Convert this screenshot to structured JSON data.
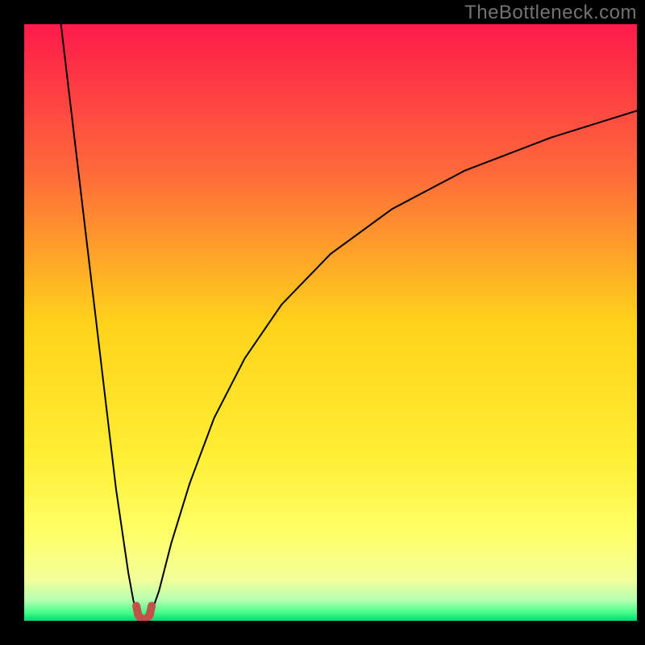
{
  "watermark": "TheBottleneck.com",
  "chart_data": {
    "type": "line",
    "title": "",
    "xlabel": "",
    "ylabel": "",
    "xlim": [
      0,
      100
    ],
    "ylim": [
      0,
      100
    ],
    "grid": false,
    "legend": false,
    "background_gradient": {
      "stops": [
        {
          "pct": 0,
          "color": "#ff1a4b"
        },
        {
          "pct": 25,
          "color": "#ff6a3a"
        },
        {
          "pct": 50,
          "color": "#ffd21a"
        },
        {
          "pct": 72,
          "color": "#ffee33"
        },
        {
          "pct": 85,
          "color": "#ffff66"
        },
        {
          "pct": 93,
          "color": "#f3ff99"
        },
        {
          "pct": 96.5,
          "color": "#b7ffb0"
        },
        {
          "pct": 98.5,
          "color": "#4dff8a"
        },
        {
          "pct": 100,
          "color": "#00d973"
        }
      ]
    },
    "series": [
      {
        "name": "left-branch",
        "color": "#000000",
        "width": 2,
        "x": [
          6.0,
          7.5,
          9.0,
          10.5,
          12.0,
          13.5,
          15.0,
          16.0,
          17.0,
          17.8,
          18.4,
          18.8
        ],
        "y": [
          100,
          87,
          74,
          61,
          48,
          35,
          22,
          15,
          8,
          3.5,
          1.0,
          0.2
        ]
      },
      {
        "name": "right-branch",
        "color": "#000000",
        "width": 2,
        "x": [
          20.2,
          20.8,
          22.0,
          24.0,
          27.0,
          31.0,
          36.0,
          42.0,
          50.0,
          60.0,
          72.0,
          86.0,
          100.0
        ],
        "y": [
          0.2,
          1.5,
          5.0,
          13.0,
          23.0,
          34.0,
          44.0,
          53.0,
          61.5,
          69.0,
          75.5,
          81.0,
          85.5
        ]
      },
      {
        "name": "bottom-blob",
        "color": "#c0524a",
        "width": 10,
        "x": [
          18.3,
          18.6,
          19.0,
          19.4,
          20.0,
          20.5,
          20.8
        ],
        "y": [
          2.5,
          1.0,
          0.4,
          0.3,
          0.4,
          1.0,
          2.5
        ]
      }
    ]
  }
}
